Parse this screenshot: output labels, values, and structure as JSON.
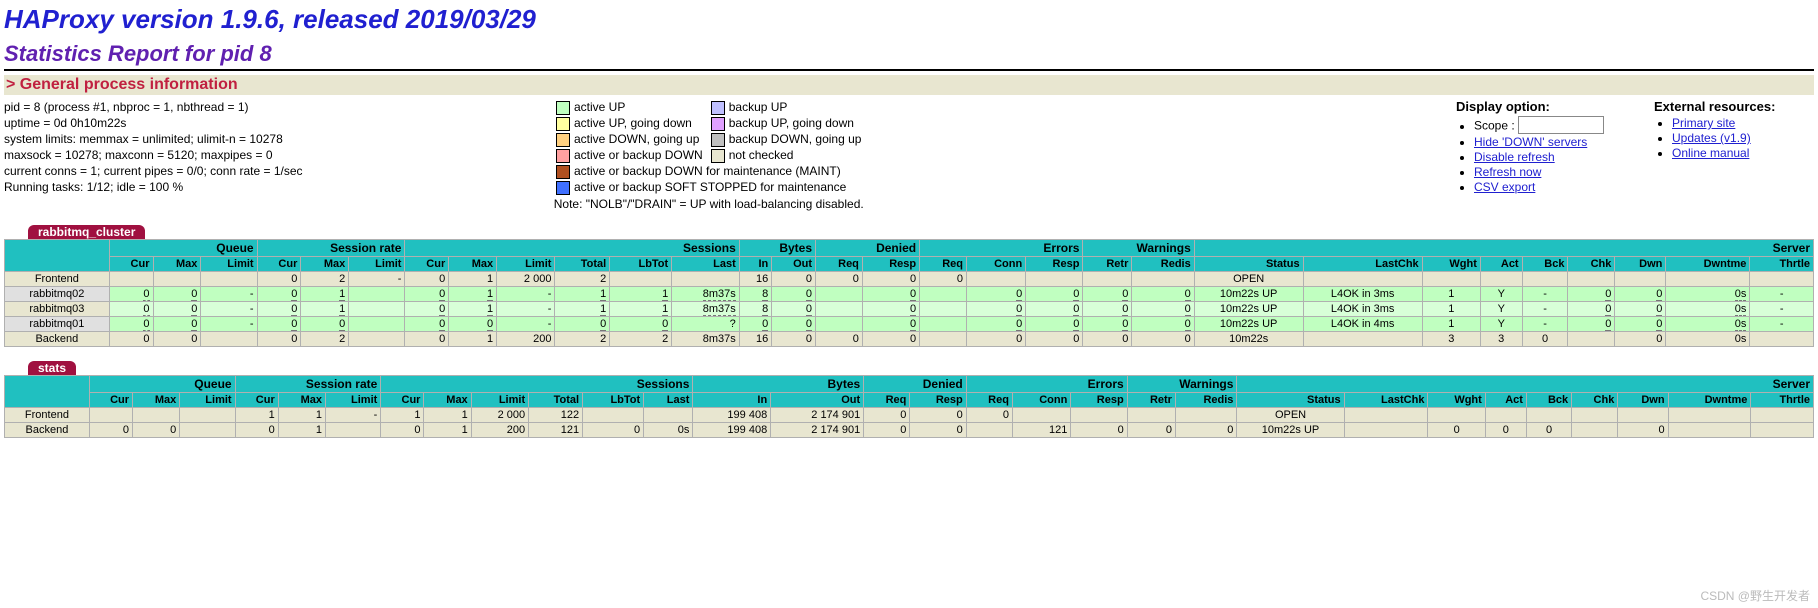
{
  "title": "HAProxy version 1.9.6, released 2019/03/29",
  "subtitle": "Statistics Report for pid 8",
  "gp_title": "> General process information",
  "process": "pid = 8 (process #1, nbproc = 1, nbthread = 1)\nuptime = 0d 0h10m22s\nsystem limits: memmax = unlimited; ulimit-n = 10278\nmaxsock = 10278; maxconn = 5120; maxpipes = 0\ncurrent conns = 1; current pipes = 0/0; conn rate = 1/sec\nRunning tasks: 1/12; idle = 100 %",
  "legend": [
    {
      "c": "#c0ffc0",
      "t": "active UP"
    },
    {
      "c": "#c0c0ff",
      "t": "backup UP"
    },
    {
      "c": "#ffffa0",
      "t": "active UP, going down"
    },
    {
      "c": "#e0a0ff",
      "t": "backup UP, going down"
    },
    {
      "c": "#ffd080",
      "t": "active DOWN, going up"
    },
    {
      "c": "#c0c0c0",
      "t": "backup DOWN, going up"
    },
    {
      "c": "#ffa0a0",
      "t": "active or backup DOWN"
    },
    {
      "c": "#e8e6d0",
      "t": "not checked"
    },
    {
      "c": "#b05020",
      "t": "active or backup DOWN for maintenance (MAINT)",
      "span": 2
    },
    {
      "c": "#4070ff",
      "t": "active or backup SOFT STOPPED for maintenance",
      "span": 2
    }
  ],
  "legend_note": "Note: \"NOLB\"/\"DRAIN\" = UP with load-balancing disabled.",
  "display": {
    "title": "Display option:",
    "scope": "Scope :",
    "items": [
      "Hide 'DOWN' servers",
      "Disable refresh",
      "Refresh now",
      "CSV export"
    ]
  },
  "external": {
    "title": "External resources:",
    "items": [
      "Primary site",
      "Updates (v1.9)",
      "Online manual"
    ]
  },
  "groups": [
    {
      "label": "Queue",
      "cols": [
        "Cur",
        "Max",
        "Limit"
      ]
    },
    {
      "label": "Session rate",
      "cols": [
        "Cur",
        "Max",
        "Limit"
      ]
    },
    {
      "label": "Sessions",
      "cols": [
        "Cur",
        "Max",
        "Limit",
        "Total",
        "LbTot",
        "Last"
      ]
    },
    {
      "label": "Bytes",
      "cols": [
        "In",
        "Out"
      ]
    },
    {
      "label": "Denied",
      "cols": [
        "Req",
        "Resp"
      ]
    },
    {
      "label": "Errors",
      "cols": [
        "Req",
        "Conn",
        "Resp"
      ]
    },
    {
      "label": "Warnings",
      "cols": [
        "Retr",
        "Redis"
      ]
    },
    {
      "label": "Server",
      "cols": [
        "Status",
        "LastChk",
        "Wght",
        "Act",
        "Bck",
        "Chk",
        "Dwn",
        "Dwntme",
        "Thrtle"
      ]
    }
  ],
  "proxies": [
    {
      "name": "rabbitmq_cluster",
      "rows": [
        {
          "t": "fe",
          "n": "Frontend",
          "v": [
            "",
            "",
            "",
            "0",
            "2",
            "-",
            "0",
            "1",
            "2 000",
            "2",
            "",
            "",
            "16",
            "0",
            "0",
            "0",
            "0",
            "",
            "",
            "",
            "",
            "OPEN",
            "",
            "",
            "",
            "",
            "",
            "",
            "",
            ""
          ]
        },
        {
          "t": "up",
          "n": "rabbitmq02",
          "v": [
            "0",
            "0",
            "-",
            "0",
            "1",
            "",
            "0",
            "1",
            "-",
            "1",
            "1",
            "8m37s",
            "8",
            "0",
            "",
            "0",
            "",
            "0",
            "0",
            "0",
            "0",
            "10m22s UP",
            "L4OK in 3ms",
            "1",
            "Y",
            "-",
            "0",
            "0",
            "0s",
            "-"
          ]
        },
        {
          "t": "upD",
          "n": "rabbitmq03",
          "v": [
            "0",
            "0",
            "-",
            "0",
            "1",
            "",
            "0",
            "1",
            "-",
            "1",
            "1",
            "8m37s",
            "8",
            "0",
            "",
            "0",
            "",
            "0",
            "0",
            "0",
            "0",
            "10m22s UP",
            "L4OK in 3ms",
            "1",
            "Y",
            "-",
            "0",
            "0",
            "0s",
            "-"
          ]
        },
        {
          "t": "up",
          "n": "rabbitmq01",
          "v": [
            "0",
            "0",
            "-",
            "0",
            "0",
            "",
            "0",
            "0",
            "-",
            "0",
            "0",
            "?",
            "0",
            "0",
            "",
            "0",
            "",
            "0",
            "0",
            "0",
            "0",
            "10m22s UP",
            "L4OK in 4ms",
            "1",
            "Y",
            "-",
            "0",
            "0",
            "0s",
            "-"
          ]
        },
        {
          "t": "be",
          "n": "Backend",
          "v": [
            "0",
            "0",
            "",
            "0",
            "2",
            "",
            "0",
            "1",
            "200",
            "2",
            "2",
            "8m37s",
            "16",
            "0",
            "0",
            "0",
            "",
            "0",
            "0",
            "0",
            "0",
            "10m22s",
            "",
            "3",
            "3",
            "0",
            "",
            "0",
            "0s",
            ""
          ]
        }
      ]
    },
    {
      "name": "stats",
      "rows": [
        {
          "t": "fe",
          "n": "Frontend",
          "v": [
            "",
            "",
            "",
            "1",
            "1",
            "-",
            "1",
            "1",
            "2 000",
            "122",
            "",
            "",
            "199 408",
            "2 174 901",
            "0",
            "0",
            "0",
            "",
            "",
            "",
            "",
            "OPEN",
            "",
            "",
            "",
            "",
            "",
            "",
            "",
            ""
          ]
        },
        {
          "t": "be",
          "n": "Backend",
          "v": [
            "0",
            "0",
            "",
            "0",
            "1",
            "",
            "0",
            "1",
            "200",
            "121",
            "0",
            "0s",
            "199 408",
            "2 174 901",
            "0",
            "0",
            "",
            "121",
            "0",
            "0",
            "0",
            "10m22s UP",
            "",
            "0",
            "0",
            "0",
            "",
            "0",
            "",
            ""
          ]
        }
      ]
    }
  ],
  "watermark": "CSDN @野生开发者"
}
